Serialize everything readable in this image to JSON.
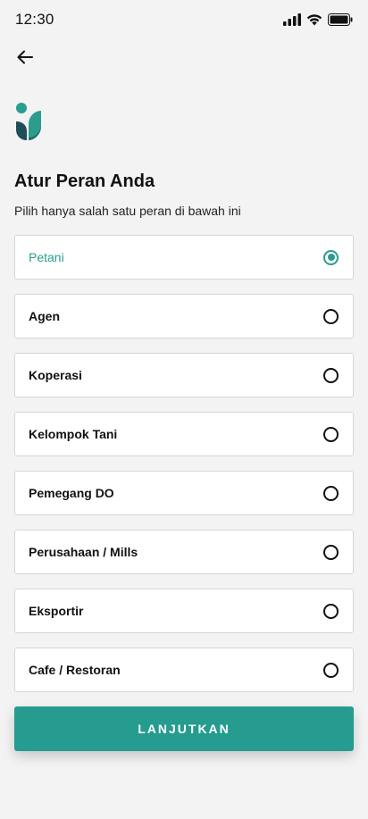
{
  "status_bar": {
    "time": "12:30",
    "icons": [
      "signal-icon",
      "wifi-icon",
      "battery-icon"
    ]
  },
  "header": {
    "back_icon": "arrow-left-icon"
  },
  "brand": {
    "logo": "app-logo",
    "colors": {
      "primary": "#259c8f",
      "dark": "#1f4e5a",
      "light": "#4fb3a6"
    }
  },
  "title": "Atur Peran Anda",
  "subtitle": "Pilih hanya salah satu peran di bawah ini",
  "roles": [
    {
      "label": "Petani",
      "selected": true
    },
    {
      "label": "Agen",
      "selected": false
    },
    {
      "label": "Koperasi",
      "selected": false
    },
    {
      "label": "Kelompok Tani",
      "selected": false
    },
    {
      "label": "Pemegang DO",
      "selected": false
    },
    {
      "label": "Perusahaan / Mills",
      "selected": false
    },
    {
      "label": "Eksportir",
      "selected": false
    },
    {
      "label": "Cafe / Restoran",
      "selected": false
    }
  ],
  "continue_button": {
    "label": "LANJUTKAN"
  }
}
